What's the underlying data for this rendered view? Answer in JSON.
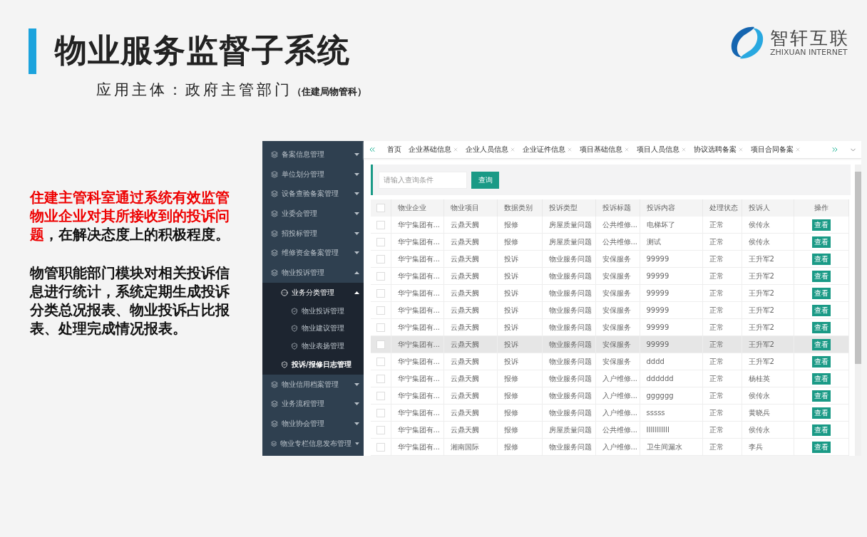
{
  "slide": {
    "title": "物业服务监督子系统",
    "subtitle": "应用主体：政府主管部门",
    "subtitle_note": "（住建局物管科）",
    "logo": {
      "name": "智轩互联",
      "tagline": "ZHIXUAN INTERNET"
    },
    "paragraphs": [
      {
        "highlight": "住建主管科室通过系统有效监管物业企业对其所接收到的投诉问题",
        "rest": "，在解决态度上的积极程度。"
      },
      {
        "rest": "物管职能部门模块对相关投诉信息进行统计，系统定期生成投诉分类总况报表、物业投诉占比报表、处理完成情况报表。"
      }
    ]
  },
  "sidebar": {
    "items": [
      {
        "label": "备案信息管理",
        "expanded": false
      },
      {
        "label": "单位划分管理",
        "expanded": false
      },
      {
        "label": "设备查验备案管理",
        "expanded": false
      },
      {
        "label": "业委会管理",
        "expanded": false
      },
      {
        "label": "招投标管理",
        "expanded": false
      },
      {
        "label": "维修资金备案管理",
        "expanded": false
      },
      {
        "label": "物业投诉管理",
        "expanded": true,
        "children": [
          {
            "label": "业务分类管理",
            "expanded": true,
            "selected": false,
            "children": [
              {
                "label": "物业投诉管理",
                "selected": false
              },
              {
                "label": "物业建议管理",
                "selected": false
              },
              {
                "label": "物业表扬管理",
                "selected": false
              }
            ]
          },
          {
            "label": "投诉/报修日志管理",
            "selected": true
          }
        ]
      },
      {
        "label": "物业信用档案管理",
        "expanded": false
      },
      {
        "label": "业务流程管理",
        "expanded": false
      },
      {
        "label": "物业协会管理",
        "expanded": false
      },
      {
        "label": "物业专栏信息发布管理",
        "expanded": false
      }
    ]
  },
  "tabs": [
    {
      "label": "首页",
      "closable": false,
      "selected": false
    },
    {
      "label": "企业基础信息",
      "closable": true,
      "selected": false
    },
    {
      "label": "企业人员信息",
      "closable": true,
      "selected": false
    },
    {
      "label": "企业证件信息",
      "closable": true,
      "selected": false
    },
    {
      "label": "项目基础信息",
      "closable": true,
      "selected": false
    },
    {
      "label": "项目人员信息",
      "closable": true,
      "selected": false
    },
    {
      "label": "协议选聘备案",
      "closable": true,
      "selected": false
    },
    {
      "label": "项目合同备案",
      "closable": true,
      "selected": false
    }
  ],
  "search": {
    "placeholder": "请输入查询条件",
    "button": "查询"
  },
  "table": {
    "all_checked": false,
    "columns": [
      "物业企业",
      "物业项目",
      "数据类别",
      "投诉类型",
      "投诉标题",
      "投诉内容",
      "处理状态",
      "投诉人",
      "操作"
    ],
    "rows": [
      {
        "checked": false,
        "highlighted": false,
        "cells": [
          "华宁集团有...",
          "云鼎天阙",
          "报修",
          "房屋质量问题",
          "公共维修...",
          "电梯坏了",
          "正常",
          "侯传永"
        ],
        "action": "查看"
      },
      {
        "checked": false,
        "highlighted": false,
        "cells": [
          "华宁集团有...",
          "云鼎天阙",
          "报修",
          "房屋质量问题",
          "公共维修...",
          "测试",
          "正常",
          "侯传永"
        ],
        "action": "查看"
      },
      {
        "checked": false,
        "highlighted": false,
        "cells": [
          "华宁集团有...",
          "云鼎天阙",
          "投诉",
          "物业服务问题",
          "安保服务",
          "99999",
          "正常",
          "王升军2"
        ],
        "action": "查看"
      },
      {
        "checked": false,
        "highlighted": false,
        "cells": [
          "华宁集团有...",
          "云鼎天阙",
          "投诉",
          "物业服务问题",
          "安保服务",
          "99999",
          "正常",
          "王升军2"
        ],
        "action": "查看"
      },
      {
        "checked": false,
        "highlighted": false,
        "cells": [
          "华宁集团有...",
          "云鼎天阙",
          "投诉",
          "物业服务问题",
          "安保服务",
          "99999",
          "正常",
          "王升军2"
        ],
        "action": "查看"
      },
      {
        "checked": false,
        "highlighted": false,
        "cells": [
          "华宁集团有...",
          "云鼎天阙",
          "投诉",
          "物业服务问题",
          "安保服务",
          "99999",
          "正常",
          "王升军2"
        ],
        "action": "查看"
      },
      {
        "checked": false,
        "highlighted": false,
        "cells": [
          "华宁集团有...",
          "云鼎天阙",
          "投诉",
          "物业服务问题",
          "安保服务",
          "99999",
          "正常",
          "王升军2"
        ],
        "action": "查看"
      },
      {
        "checked": false,
        "highlighted": true,
        "cells": [
          "华宁集团有...",
          "云鼎天阙",
          "投诉",
          "物业服务问题",
          "安保服务",
          "99999",
          "正常",
          "王升军2"
        ],
        "action": "查看"
      },
      {
        "checked": false,
        "highlighted": false,
        "cells": [
          "华宁集团有...",
          "云鼎天阙",
          "投诉",
          "物业服务问题",
          "安保服务",
          "dddd",
          "正常",
          "王升军2"
        ],
        "action": "查看"
      },
      {
        "checked": false,
        "highlighted": false,
        "cells": [
          "华宁集团有...",
          "云鼎天阙",
          "报修",
          "物业服务问题",
          "入户维修...",
          "dddddd",
          "正常",
          "杨桂英"
        ],
        "action": "查看"
      },
      {
        "checked": false,
        "highlighted": false,
        "cells": [
          "华宁集团有...",
          "云鼎天阙",
          "报修",
          "物业服务问题",
          "入户维修...",
          "gggggg",
          "正常",
          "侯传永"
        ],
        "action": "查看"
      },
      {
        "checked": false,
        "highlighted": false,
        "cells": [
          "华宁集团有...",
          "云鼎天阙",
          "报修",
          "物业服务问题",
          "入户维修...",
          "sssss",
          "正常",
          "黄晓兵"
        ],
        "action": "查看"
      },
      {
        "checked": false,
        "highlighted": false,
        "cells": [
          "华宁集团有...",
          "云鼎天阙",
          "报修",
          "房屋质量问题",
          "公共维修...",
          "IIIIIIIIIII",
          "正常",
          "侯传永"
        ],
        "action": "查看"
      },
      {
        "checked": false,
        "highlighted": false,
        "cells": [
          "华宁集团有...",
          "湘南国际",
          "报修",
          "物业服务问题",
          "入户维修...",
          "卫生间漏水",
          "正常",
          "李兵"
        ],
        "action": "查看"
      }
    ]
  }
}
